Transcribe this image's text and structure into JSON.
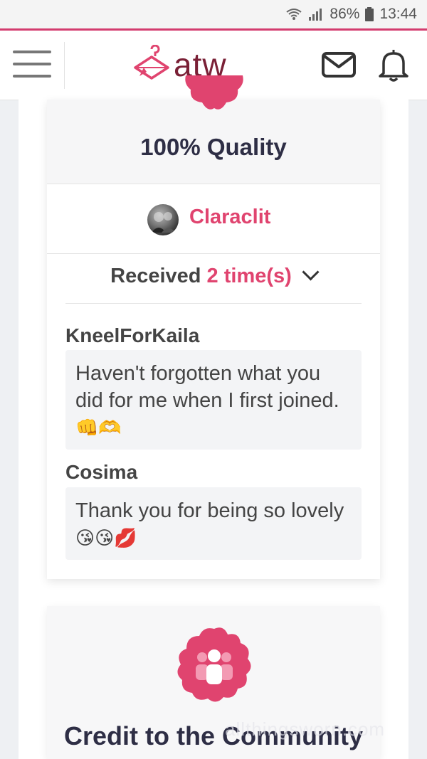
{
  "status_bar": {
    "battery": "86%",
    "time": "13:44"
  },
  "header": {
    "logo_text": "atw"
  },
  "award": {
    "title": "100% Quality",
    "giver": "Claraclit",
    "received_prefix": "Received",
    "received_count": "2 time(s)"
  },
  "comments": [
    {
      "author": "KneelForKaila",
      "text": "Haven't forgotten what you did for me when I first joined. ",
      "emoji": "👊🫶"
    },
    {
      "author": "Cosima",
      "text": "Thank you for being so lovely ",
      "emoji": "😘😘💋"
    }
  ],
  "next_award": {
    "title": "Credit to the Community"
  },
  "watermark": "allthingsworn.com",
  "colors": {
    "accent": "#e0446f",
    "brand": "#7a2036",
    "text_dark": "#2e2e45"
  }
}
